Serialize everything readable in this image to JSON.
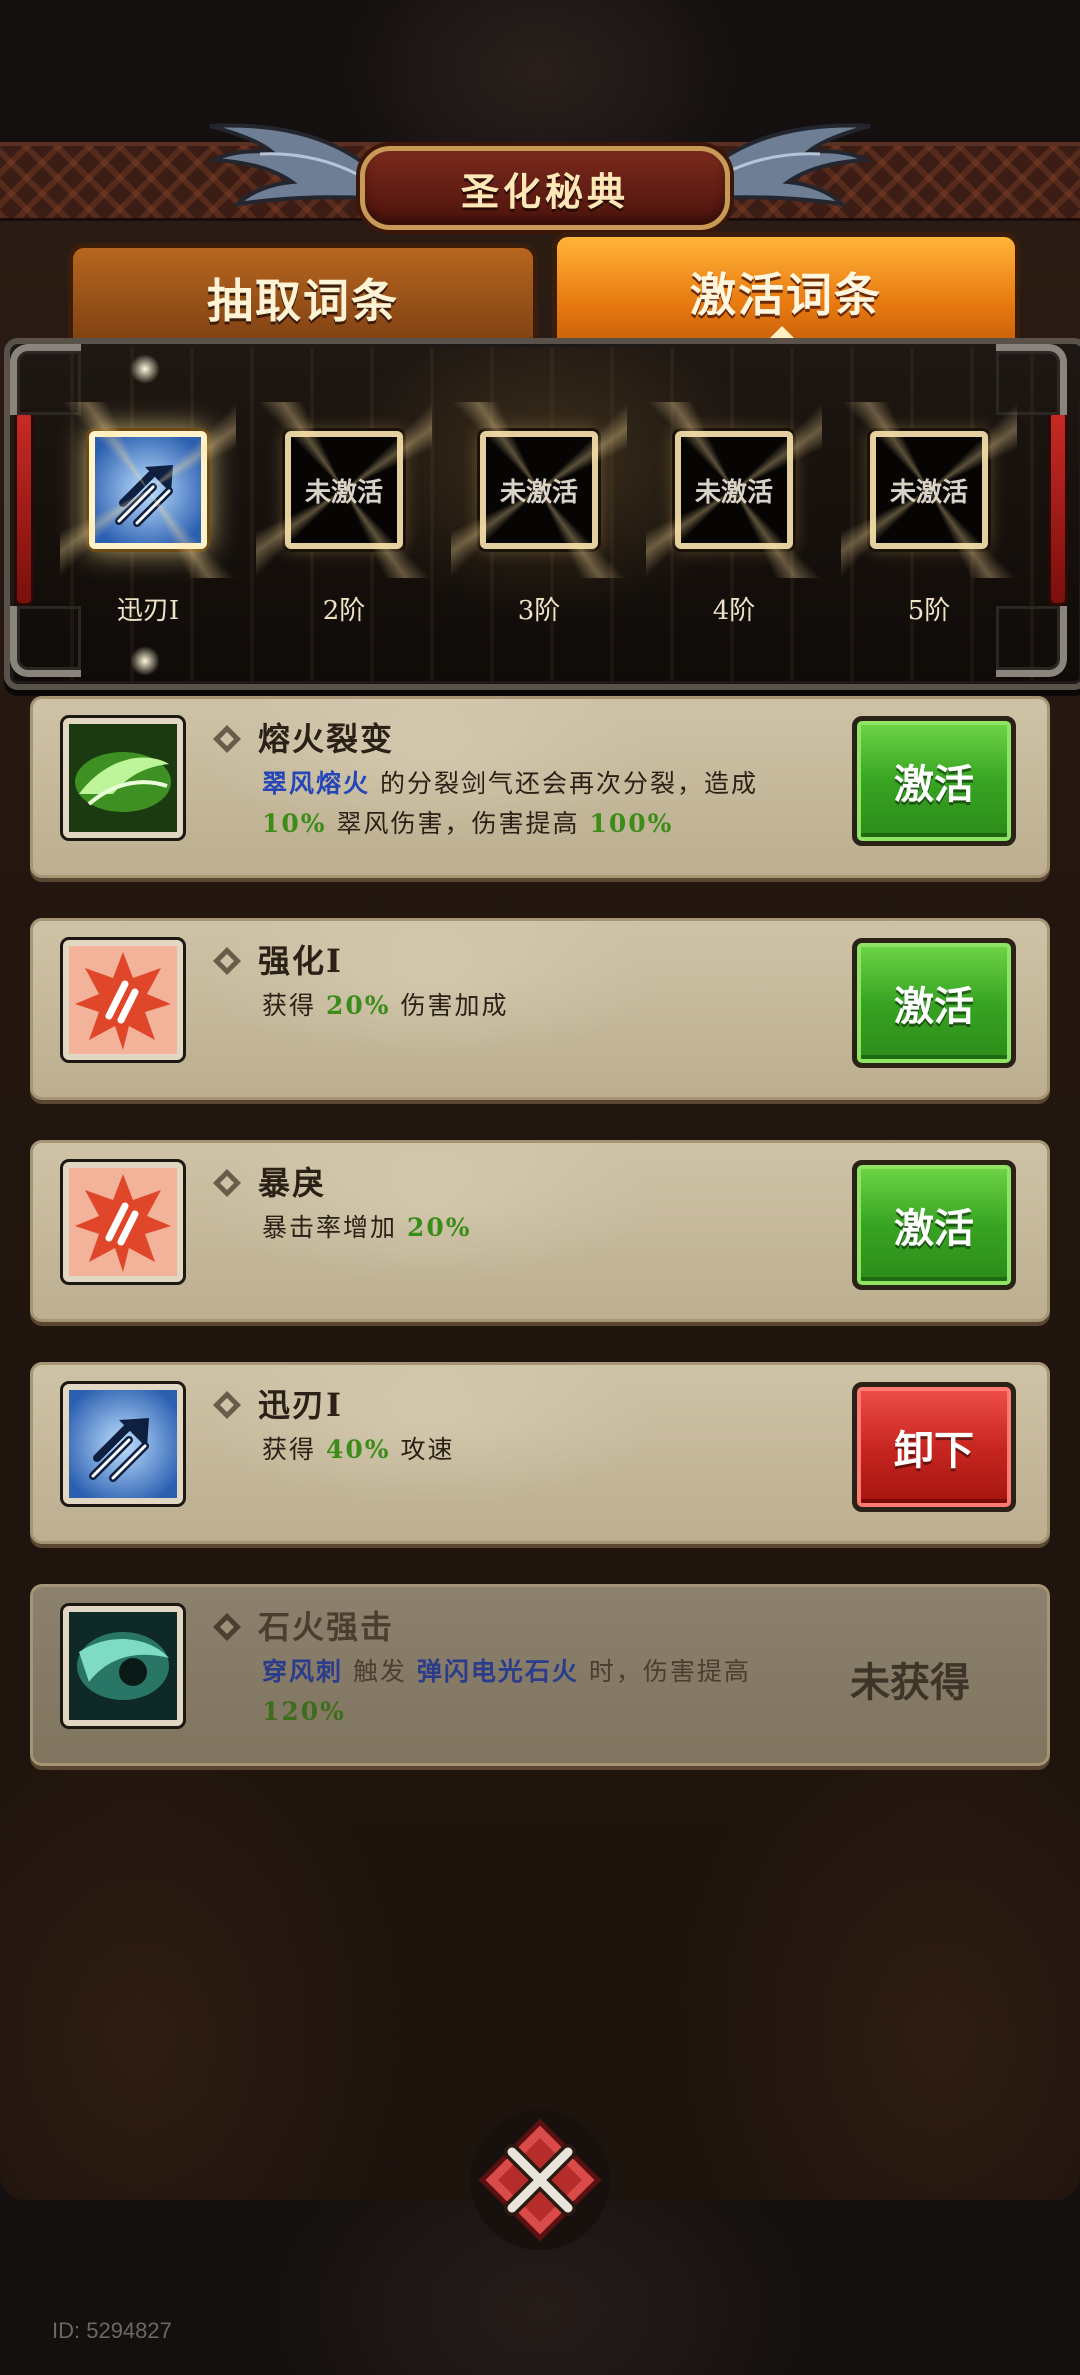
{
  "title": "圣化秘典",
  "tabs": [
    {
      "label": "抽取词条",
      "active": false
    },
    {
      "label": "激活词条",
      "active": true
    }
  ],
  "tiers": [
    {
      "slot_text": "",
      "label": "迅刃Ⅰ",
      "icon": "blue-arrow-skill-icon",
      "current": true
    },
    {
      "slot_text": "未激活",
      "label": "2阶"
    },
    {
      "slot_text": "未激活",
      "label": "3阶"
    },
    {
      "slot_text": "未激活",
      "label": "4阶"
    },
    {
      "slot_text": "未激活",
      "label": "5阶"
    }
  ],
  "entries": [
    {
      "name": "熔火裂变",
      "icon": "green-wind-slash-icon",
      "desc": [
        {
          "t": "翠风熔火",
          "c": "blue"
        },
        {
          "t": " 的分裂剑气还会再次分裂，造成 ",
          "c": ""
        },
        {
          "t": "10%",
          "c": "green"
        },
        {
          "t": " 翠风伤害，伤害提高 ",
          "c": ""
        },
        {
          "t": "100%",
          "c": "green"
        }
      ],
      "button": "激活",
      "button_type": "activate"
    },
    {
      "name": "强化Ⅰ",
      "icon": "red-power-burst-icon",
      "desc": [
        {
          "t": "获得 ",
          "c": ""
        },
        {
          "t": "20%",
          "c": "green"
        },
        {
          "t": " 伤害加成",
          "c": ""
        }
      ],
      "button": "激活",
      "button_type": "activate"
    },
    {
      "name": "暴戾",
      "icon": "red-power-burst-icon",
      "desc": [
        {
          "t": "暴击率增加 ",
          "c": ""
        },
        {
          "t": "20%",
          "c": "green"
        }
      ],
      "button": "激活",
      "button_type": "activate"
    },
    {
      "name": "迅刃Ⅰ",
      "icon": "blue-arrow-skill-icon",
      "desc": [
        {
          "t": "获得 ",
          "c": ""
        },
        {
          "t": "40%",
          "c": "green"
        },
        {
          "t": " 攻速",
          "c": ""
        }
      ],
      "button": "卸下",
      "button_type": "unequip"
    },
    {
      "name": "石火强击",
      "icon": "teal-wind-strike-icon",
      "desc": [
        {
          "t": "穿风刺",
          "c": "blue"
        },
        {
          "t": " 触发 ",
          "c": ""
        },
        {
          "t": "弹闪电光石火",
          "c": "blue"
        },
        {
          "t": " 时，伤害提高 ",
          "c": ""
        },
        {
          "t": "120%",
          "c": "green"
        }
      ],
      "status": "未获得",
      "locked": true
    }
  ],
  "footer": {
    "id_text": "ID: 5294827"
  },
  "colors": {
    "highlight_blue": "#2446b8",
    "highlight_green": "#3c8c19",
    "activate_button": "#38a423",
    "unequip_button": "#c82620",
    "active_tab": "#e87a10"
  }
}
